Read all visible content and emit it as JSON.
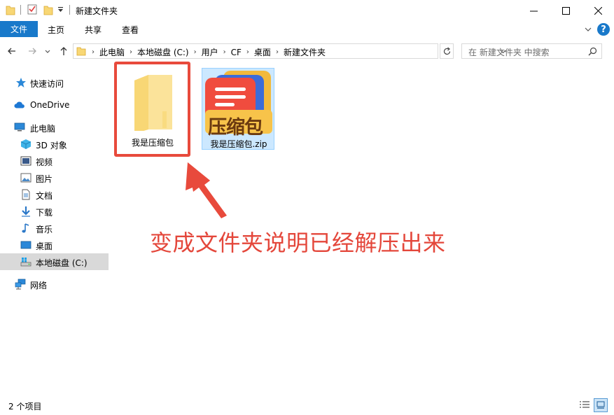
{
  "window": {
    "title": "新建文件夹",
    "minimize_glyph": "—",
    "maximize_glyph": "☐",
    "close_glyph": "✕"
  },
  "ribbon": {
    "tabs": [
      "文件",
      "主页",
      "共享",
      "查看"
    ],
    "help_glyph": "?"
  },
  "address": {
    "breadcrumbs": [
      "此电脑",
      "本地磁盘 (C:)",
      "用户",
      "CF",
      "桌面",
      "新建文件夹"
    ],
    "separator": "›",
    "search_placeholder": "在 新建文件夹 中搜索"
  },
  "sidebar": {
    "items": [
      {
        "label": "快速访问",
        "icon": "star-icon"
      },
      {
        "label": "OneDrive",
        "icon": "cloud-icon"
      },
      {
        "label": "此电脑",
        "icon": "computer-icon"
      },
      {
        "label": "3D 对象",
        "icon": "cube-icon"
      },
      {
        "label": "视频",
        "icon": "video-icon"
      },
      {
        "label": "图片",
        "icon": "picture-icon"
      },
      {
        "label": "文档",
        "icon": "document-icon"
      },
      {
        "label": "下载",
        "icon": "download-icon"
      },
      {
        "label": "音乐",
        "icon": "music-icon"
      },
      {
        "label": "桌面",
        "icon": "desktop-icon"
      },
      {
        "label": "本地磁盘 (C:)",
        "icon": "drive-icon",
        "selected": true
      },
      {
        "label": "网络",
        "icon": "network-icon"
      }
    ]
  },
  "files": [
    {
      "name": "我是压缩包",
      "type": "folder"
    },
    {
      "name": "我是压缩包.zip",
      "type": "zip",
      "icon_text": "压缩包",
      "selected": true
    }
  ],
  "annotation": {
    "text": "变成文件夹说明已经解压出来",
    "color": "#e4473b"
  },
  "status": {
    "item_count": "2 个项目"
  },
  "colors": {
    "accent": "#1979ca",
    "selection": "#cce8ff",
    "folder": "#f8d775",
    "annotation_red": "#e84a3c"
  }
}
